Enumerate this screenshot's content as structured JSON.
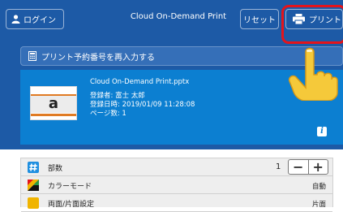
{
  "header": {
    "login_label": "ログイン",
    "title": "Cloud On-Demand Print",
    "reset_label": "リセット",
    "print_label": "プリント"
  },
  "reenter": {
    "label": "プリント予約番号を再入力する"
  },
  "document": {
    "filename": "Cloud On-Demand Print.pptx",
    "registrant": "登録者: 富士 太郎",
    "registered_at": "登録日時: 2019/01/09 11:28:08",
    "pages": "ページ数: 1",
    "thumbnail_letter": "a"
  },
  "settings": {
    "copies": {
      "label": "部数",
      "value": "1"
    },
    "color_mode": {
      "label": "カラーモード",
      "value": "自動"
    },
    "duplex": {
      "label": "両面/片面設定",
      "value": "片面"
    }
  },
  "colors": {
    "header_bg": "#1d5aa6",
    "panel_bg": "#0c7fd1",
    "highlight": "#e4141b",
    "copies_icon": "#1f8fe0"
  },
  "icons": [
    "user-icon",
    "printer-icon",
    "keypad-icon",
    "info-icon",
    "pointing-hand-icon",
    "hash-icon",
    "color-mode-icon",
    "duplex-icon"
  ]
}
